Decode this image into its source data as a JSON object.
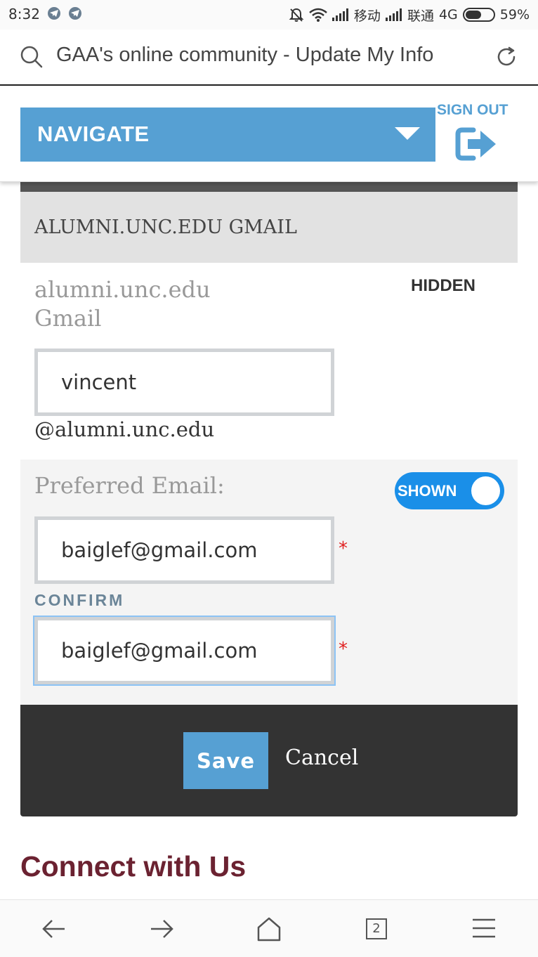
{
  "status_bar": {
    "time": "8:32",
    "carrier_1": "移动",
    "carrier_2": "联通",
    "network": "4G",
    "battery": "59%",
    "battery_level": 0.59,
    "icons": [
      "telegram-icon",
      "telegram-icon",
      "bell-off-icon",
      "wifi-icon",
      "signal-icon",
      "signal-icon",
      "battery-icon"
    ]
  },
  "browser": {
    "address_title": "GAA's online community - Update My Info",
    "tab_count": "2"
  },
  "header": {
    "navigate_label": "NAVIGATE",
    "sign_out_label": "SIGN OUT"
  },
  "section": {
    "title": "ALUMNI.UNC.EDU GMAIL",
    "field_label_line1": "alumni.unc.edu",
    "field_label_line2": "Gmail",
    "visibility": "HIDDEN",
    "gmail_username": "vincent",
    "domain_suffix": "@alumni.unc.edu"
  },
  "preferred": {
    "label": "Preferred Email:",
    "toggle_label": "SHOWN",
    "email": "baiglef@gmail.com",
    "confirm_label": "CONFIRM",
    "confirm_email": "baiglef@gmail.com",
    "required_mark": "*"
  },
  "actions": {
    "save_label": "Save",
    "cancel_label": "Cancel"
  },
  "footer": {
    "connect_title": "Connect with Us"
  },
  "colors": {
    "accent_blue": "#56a0d3",
    "toggle_blue": "#1a8fe8",
    "brand_maroon": "#6b2231",
    "action_bar": "#333333",
    "required_red": "#e02020"
  }
}
